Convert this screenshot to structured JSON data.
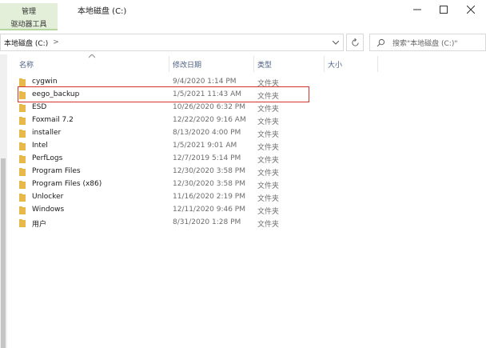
{
  "ribbon": {
    "tab_label": "管理",
    "sub_label": "驱动器工具"
  },
  "window": {
    "title": "本地磁盘 (C:)"
  },
  "address": {
    "path": "本地磁盘 (C:)",
    "separator": ">"
  },
  "search": {
    "placeholder": "搜索\"本地磁盘 (C:)\""
  },
  "columns": {
    "name": "名称",
    "date": "修改日期",
    "type": "类型",
    "size": "大小"
  },
  "colors": {
    "folder": "#e8b84a",
    "highlight": "#d9342b",
    "header_text": "#4d6082"
  },
  "files": [
    {
      "name": "cygwin",
      "date": "9/4/2020 1:14 PM",
      "type": "文件夹"
    },
    {
      "name": "eego_backup",
      "date": "1/5/2021 11:43 AM",
      "type": "文件夹"
    },
    {
      "name": "ESD",
      "date": "10/26/2020 6:32 PM",
      "type": "文件夹"
    },
    {
      "name": "Foxmail 7.2",
      "date": "12/22/2020 9:16 AM",
      "type": "文件夹"
    },
    {
      "name": "installer",
      "date": "8/13/2020 4:00 PM",
      "type": "文件夹"
    },
    {
      "name": "Intel",
      "date": "1/5/2021 9:01 AM",
      "type": "文件夹"
    },
    {
      "name": "PerfLogs",
      "date": "12/7/2019 5:14 PM",
      "type": "文件夹"
    },
    {
      "name": "Program Files",
      "date": "12/30/2020 3:58 PM",
      "type": "文件夹"
    },
    {
      "name": "Program Files (x86)",
      "date": "12/30/2020 3:58 PM",
      "type": "文件夹"
    },
    {
      "name": "Unlocker",
      "date": "11/16/2020 2:19 PM",
      "type": "文件夹"
    },
    {
      "name": "Windows",
      "date": "12/11/2020 9:46 PM",
      "type": "文件夹"
    },
    {
      "name": "用户",
      "date": "8/31/2020 1:28 PM",
      "type": "文件夹"
    }
  ]
}
